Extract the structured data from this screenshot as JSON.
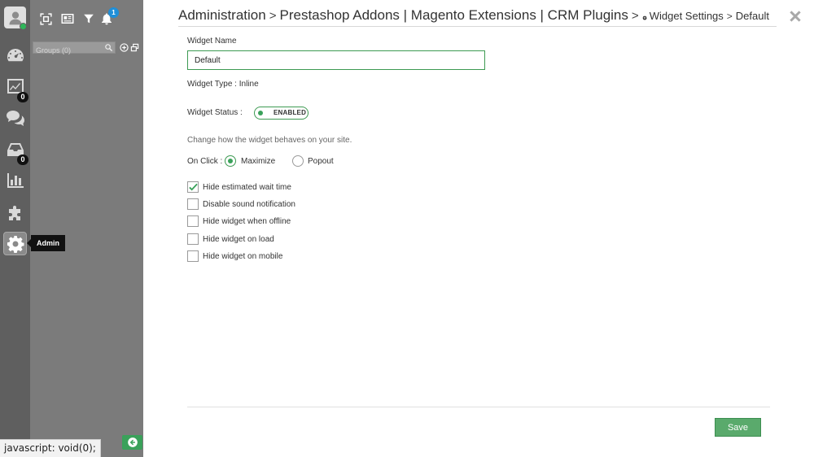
{
  "sidebar_rail": {
    "items": [
      {
        "name": "dashboard",
        "icon": "dashboard-icon"
      },
      {
        "name": "analytics",
        "icon": "line-chart-icon",
        "badge": "0"
      },
      {
        "name": "chats",
        "icon": "chat-bubbles-icon"
      },
      {
        "name": "inbox",
        "icon": "inbox-tray-icon",
        "badge": "0"
      },
      {
        "name": "reports",
        "icon": "bar-chart-icon"
      },
      {
        "name": "integrations",
        "icon": "puzzle-icon"
      },
      {
        "name": "admin",
        "icon": "gear-icon",
        "active": true
      }
    ],
    "admin_tooltip": "Admin"
  },
  "panel": {
    "bell_count": "1",
    "groups_search_placeholder": "Groups (0)"
  },
  "header": {
    "crumb_1": "Administration",
    "crumb_2": "Prestashop Addons | Magento Extensions | CRM Plugins",
    "crumb_3": "Widget Settings",
    "crumb_4": "Default",
    "separator": ">"
  },
  "form": {
    "widget_name_label": "Widget Name",
    "widget_name_value": "Default",
    "widget_type_text": "Widget Type : Inline",
    "widget_status_label": "Widget Status :",
    "widget_status_value": "ENABLED",
    "behavior_hint": "Change how the widget behaves on your site.",
    "on_click_label": "On Click :",
    "on_click_options": [
      "Maximize",
      "Popout"
    ],
    "on_click_selected": "Maximize",
    "checkboxes": [
      {
        "label": "Hide estimated wait time",
        "checked": true
      },
      {
        "label": "Disable sound notification",
        "checked": false
      },
      {
        "label": "Hide widget when offline",
        "checked": false
      },
      {
        "label": "Hide widget on load",
        "checked": false
      },
      {
        "label": "Hide widget on mobile",
        "checked": false
      }
    ],
    "save_label": "Save"
  },
  "status_bar": "javascript: void(0);",
  "colors": {
    "rail_bg": "#5f5f5f",
    "panel_bg": "#7b7b7b",
    "accent_green": "#3aa15a",
    "save_green": "#5aaa6c",
    "bell_badge_blue": "#1f8fd8"
  }
}
